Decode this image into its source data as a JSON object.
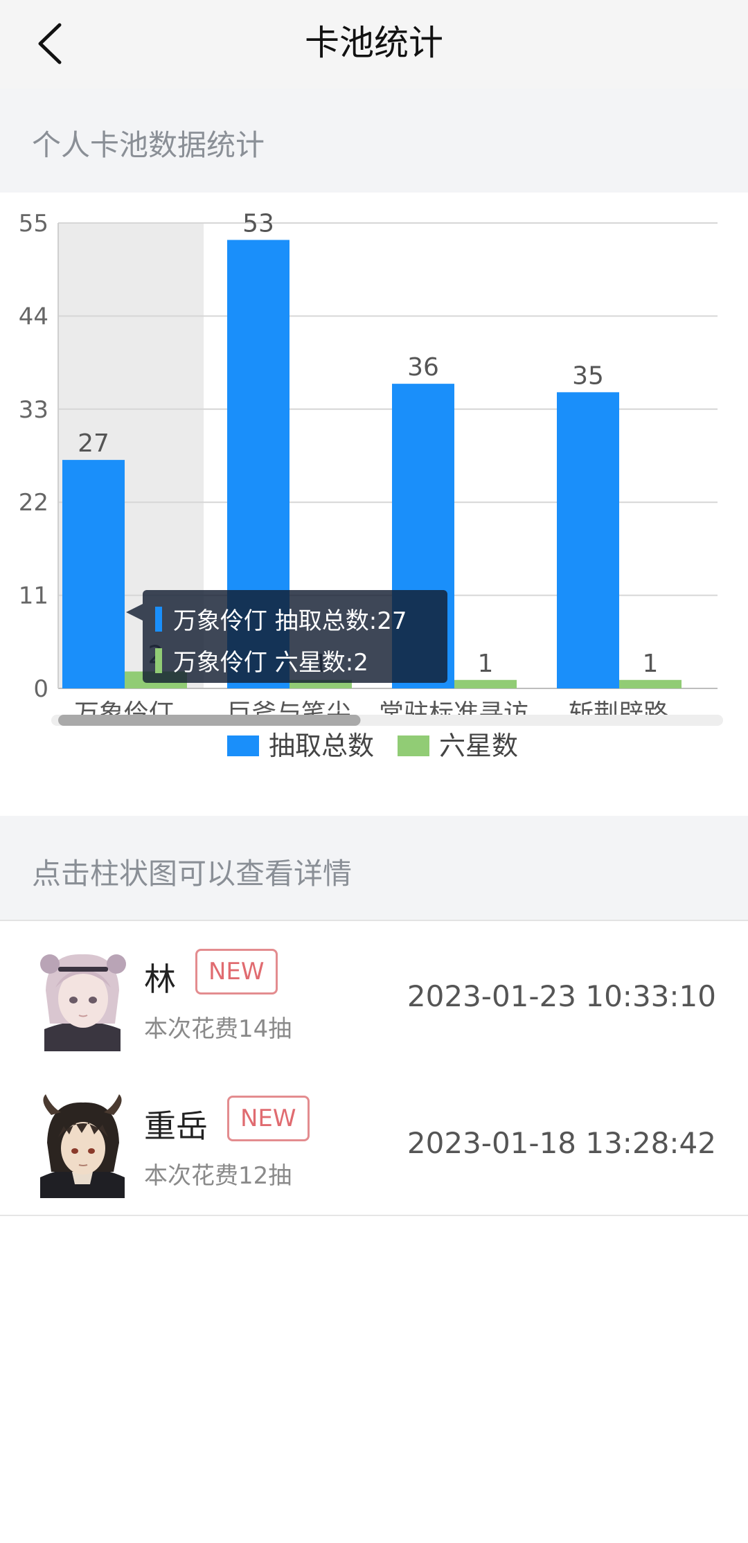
{
  "header": {
    "title": "卡池统计",
    "back_icon": "chevron-left-icon"
  },
  "section_stats": {
    "label": "个人卡池数据统计"
  },
  "chart_data": {
    "type": "bar",
    "categories": [
      "万象伶仃",
      "巨斧与笔尖",
      "常驻标准寻访",
      "斩荆辟路"
    ],
    "series": [
      {
        "name": "抽取总数",
        "values": [
          27,
          53,
          36,
          35
        ],
        "color": "#1a8ffa"
      },
      {
        "name": "六星数",
        "values": [
          2,
          1,
          1,
          1
        ],
        "color": "#91cc75"
      }
    ],
    "ylim": [
      0,
      55
    ],
    "yticks": [
      0,
      11,
      22,
      33,
      44,
      55
    ],
    "grid": true,
    "legend_position": "bottom",
    "highlighted_category": "万象伶仃",
    "tooltip": {
      "line1": "万象伶仃 抽取总数:27",
      "line2": "万象伶仃 六星数:2"
    },
    "scrollbar_position_fraction": 0.45
  },
  "section_hint": {
    "label": "点击柱状图可以查看详情"
  },
  "records": [
    {
      "name": "林",
      "badge": "NEW",
      "cost": "本次花费14抽",
      "time": "2023-01-23 10:33:10"
    },
    {
      "name": "重岳",
      "badge": "NEW",
      "cost": "本次花费12抽",
      "time": "2023-01-18 13:28:42"
    }
  ]
}
